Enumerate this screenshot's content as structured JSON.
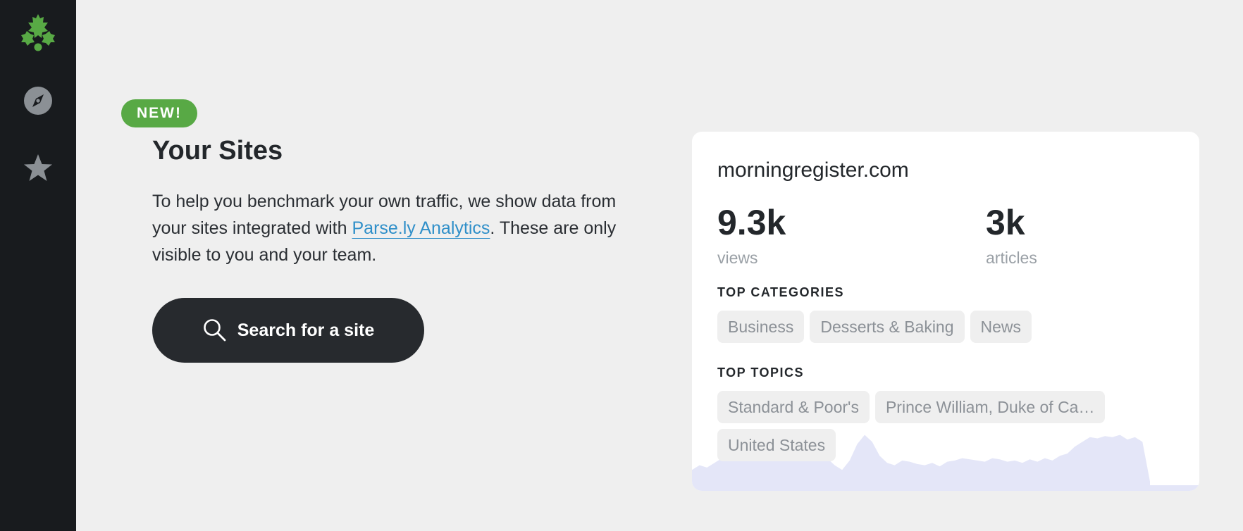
{
  "sidebar": {
    "items": [
      {
        "icon": "parsely-leaf-logo-icon",
        "color": "#58a945"
      },
      {
        "icon": "compass-icon",
        "color": "#8b9095"
      },
      {
        "icon": "star-icon",
        "color": "#8b9095"
      }
    ]
  },
  "header": {
    "badge": "NEW!",
    "title": "Your Sites"
  },
  "intro": {
    "before_link": "To help you benchmark your own traffic, we show data from your sites integrated with ",
    "link": "Parse.ly Analytics",
    "after_link": ". These are only visible to you and your team."
  },
  "search_button": {
    "label": "Search for a site",
    "icon": "search-icon"
  },
  "site_card": {
    "domain": "morningregister.com",
    "views": {
      "value": "9.3k",
      "label": "views"
    },
    "articles": {
      "value": "3k",
      "label": "articles"
    },
    "top_categories_label": "TOP CATEGORIES",
    "categories": [
      "Business",
      "Desserts & Baking",
      "News"
    ],
    "top_topics_label": "TOP TOPICS",
    "topics": [
      "Standard & Poor's",
      "Prince William, Duke of Ca…",
      "United States"
    ],
    "sparkline_color": "#e4e6f8",
    "sparkline_values": [
      18,
      22,
      20,
      24,
      28,
      32,
      29,
      30,
      27,
      36,
      40,
      42,
      46,
      43,
      45,
      41,
      38,
      34,
      28,
      22,
      18,
      26,
      40,
      48,
      42,
      30,
      24,
      22,
      26,
      25,
      23,
      22,
      24,
      21,
      25,
      26,
      28,
      27,
      26,
      25,
      28,
      27,
      25,
      26,
      24,
      27,
      25,
      28,
      26,
      30,
      32,
      38,
      42,
      46,
      45,
      47,
      46,
      48,
      44,
      46,
      42,
      8
    ]
  },
  "colors": {
    "sidebar_bg": "#181b1e",
    "accent_green": "#58a945",
    "link_blue": "#2f8fc9",
    "button_dark": "#272a2e",
    "page_bg": "#efefef"
  }
}
